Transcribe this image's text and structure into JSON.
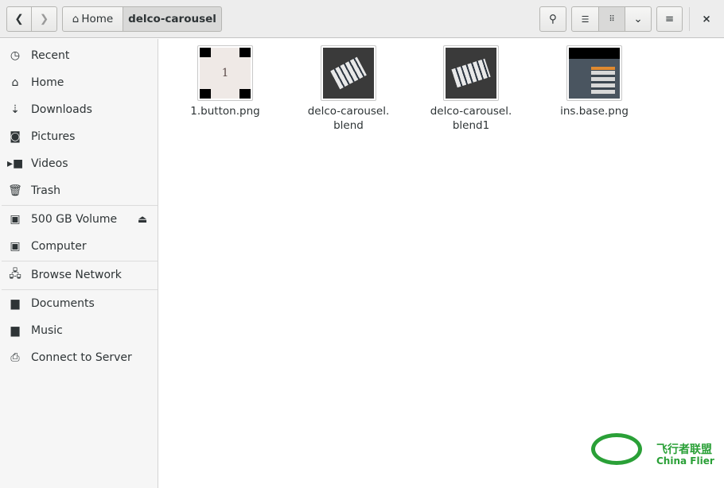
{
  "header": {
    "path": [
      "Home",
      "delco-carousel"
    ],
    "close": "×"
  },
  "sidebar": {
    "items": [
      {
        "label": "Recent",
        "icon": "clock-icon"
      },
      {
        "label": "Home",
        "icon": "home-icon"
      },
      {
        "label": "Downloads",
        "icon": "download-icon"
      },
      {
        "label": "Pictures",
        "icon": "camera-icon"
      },
      {
        "label": "Videos",
        "icon": "video-icon"
      },
      {
        "label": "Trash",
        "icon": "trash-icon"
      },
      {
        "label": "500 GB Volume",
        "icon": "drive-icon"
      },
      {
        "label": "Computer",
        "icon": "drive-icon"
      },
      {
        "label": "Browse Network",
        "icon": "network-icon"
      },
      {
        "label": "Documents",
        "icon": "folder-icon"
      },
      {
        "label": "Music",
        "icon": "folder-icon"
      },
      {
        "label": "Connect to Server",
        "icon": "server-icon"
      }
    ]
  },
  "files": [
    {
      "line1": "1.button.png",
      "line2": ""
    },
    {
      "line1": "delco-carousel.",
      "line2": "blend"
    },
    {
      "line1": "delco-carousel.",
      "line2": "blend1"
    },
    {
      "line1": "ins.base.png",
      "line2": ""
    }
  ],
  "watermark": {
    "cn": "飞行者联盟",
    "en": "China Flier"
  }
}
